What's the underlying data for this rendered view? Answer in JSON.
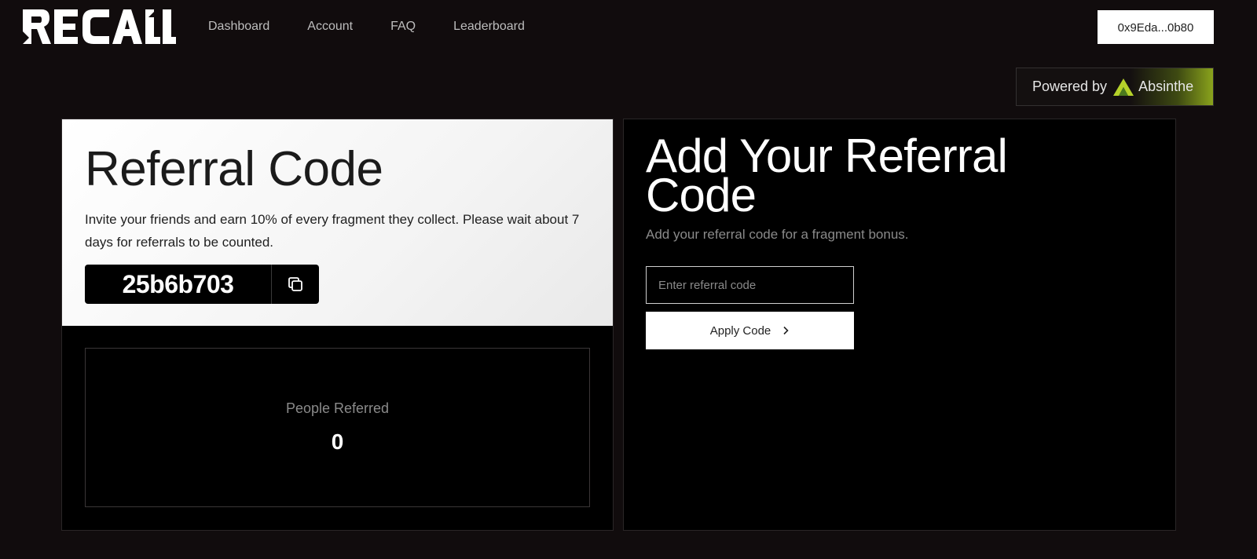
{
  "header": {
    "logo_text": "RECALL",
    "nav": [
      {
        "label": "Dashboard"
      },
      {
        "label": "Account"
      },
      {
        "label": "FAQ"
      },
      {
        "label": "Leaderboard"
      }
    ],
    "wallet_address": "0x9Eda...0b80"
  },
  "powered_by": {
    "prefix": "Powered by",
    "brand": "Absinthe",
    "brand_icon": "absinthe-logo-icon",
    "accent_color": "#b5d22a"
  },
  "referral": {
    "title": "Referral Code",
    "description": "Invite your friends and earn 10% of every fragment they collect. Please wait about 7 days for referrals to be counted.",
    "code": "25b6b703",
    "copy_icon": "copy-icon",
    "stats": {
      "label": "People Referred",
      "value": "0"
    }
  },
  "add_referral": {
    "title": "Add Your Referral Code",
    "subtitle": "Add your referral code for a fragment bonus.",
    "input_placeholder": "Enter referral code",
    "input_value": "",
    "apply_label": "Apply Code",
    "apply_icon": "chevron-right-icon"
  }
}
